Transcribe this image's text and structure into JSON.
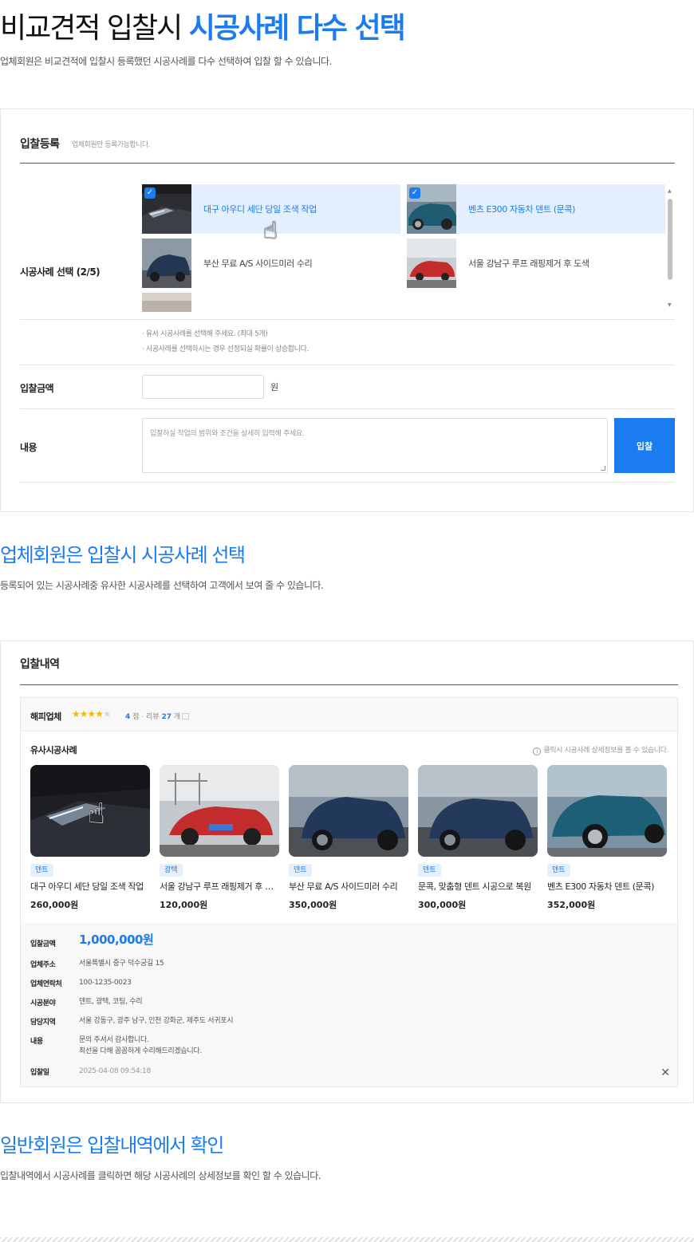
{
  "section1": {
    "title_plain": "비교견적 입찰시 ",
    "title_highlight": "시공사례 다수 선택",
    "description": "업체회원은 비교견적에 입찰시 등록했던 시공사례를 다수 선택하여 입찰 할 수 있습니다."
  },
  "register": {
    "title": "입찰등록",
    "subtitle": "업체회원만 등록가능합니다.",
    "case_label": "시공사례 선택 (2/5)",
    "cases": [
      {
        "label": "대구 아우디 세단 당일 조색 작업",
        "selected": true
      },
      {
        "label": "벤츠 E300 자동차 덴트 (문콕)",
        "selected": true
      },
      {
        "label": "부산 무료 A/S 사이드미러 수리",
        "selected": false
      },
      {
        "label": "서울 강남구 루프 래핑제거 후 도색",
        "selected": false
      }
    ],
    "hint1": "· 유사 시공사례를 선택해 주세요. (최대 5개)",
    "hint2": "· 시공사례를 선택하시는 경우 선정되실 확률이 상승합니다.",
    "amount_label": "입찰금액",
    "amount_value": "",
    "amount_unit": "원",
    "content_label": "내용",
    "content_placeholder": "입찰하실 작업의 범위와 조건을 상세히 입력해 주세요.",
    "submit_label": "입찰"
  },
  "section2": {
    "title": "업체회원은 입찰시 시공사례 선택",
    "description": "등록되어 있는 시공사례중 유사한 시공사례를 선택하여 고객에서 보여 줄 수 있습니다."
  },
  "history": {
    "title": "입찰내역",
    "company": "해피업체",
    "rating": 4,
    "rating_suffix": "점 · 리뷰",
    "review_count": "27",
    "review_suffix": "개",
    "similar_title": "유사시공사례",
    "similar_note": "클릭시 시공사례 상세정보를 볼 수 있습니다.",
    "items": [
      {
        "tag": "덴트",
        "name": "대구 아우디 세단 당일 조색 작업",
        "price": "260,000원"
      },
      {
        "tag": "광택",
        "name": "서울 강남구 루프 래핑제거 후 도색",
        "price": "120,000원"
      },
      {
        "tag": "덴트",
        "name": "부산 무료 A/S 사이드미러 수리",
        "price": "350,000원"
      },
      {
        "tag": "덴트",
        "name": "문콕, 맞춤형 덴트 시공으로 복원",
        "price": "300,000원"
      },
      {
        "tag": "덴트",
        "name": "벤츠 E300 자동차 덴트 (문콕)",
        "price": "352,000원"
      }
    ],
    "detail": {
      "amount_label": "입찰금액",
      "amount": "1,000,000원",
      "address_label": "업체주소",
      "address": "서울특별시 중구 덕수궁길 15",
      "phone_label": "업체연락처",
      "phone": "100-1235-0023",
      "field_label": "시공분야",
      "field": "덴트, 광택, 코팅, 수리",
      "region_label": "담당지역",
      "region": "서울 강동구, 광주 남구, 인천 강화군, 제주도 서귀포시",
      "content_label": "내용",
      "content_line1": "문의 주셔서 감사합니다.",
      "content_line2": "최선을 다해 꼼꼼하게 수리해드리겠습니다.",
      "date_label": "입찰일",
      "date": "2025-04-08 09:54:18"
    }
  },
  "section3": {
    "title": "일반회원은 입찰내역에서 확인",
    "description": "입찰내역에서 시공사례를 클릭하면 해당 시공사례의 상세정보를 확인 할 수 있습니다."
  },
  "colors": {
    "accent": "#1a7cf0",
    "selected_bg": "#e3effd",
    "star": "#f5b800"
  },
  "icons": [
    "check-icon",
    "hand-cursor-icon",
    "star-icon",
    "comment-icon",
    "info-icon",
    "close-icon"
  ]
}
